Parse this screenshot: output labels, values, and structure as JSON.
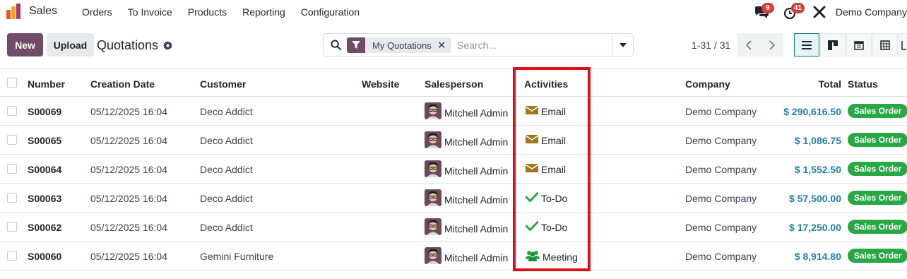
{
  "nav": {
    "app_name": "Sales",
    "menu": [
      "Orders",
      "To Invoice",
      "Products",
      "Reporting",
      "Configuration"
    ],
    "messages_count": "9",
    "activities_count": "41",
    "company": "Demo Company"
  },
  "control": {
    "new_label": "New",
    "upload_label": "Upload",
    "title": "Quotations",
    "facet_label": "My Quotations",
    "search_placeholder": "Search...",
    "pager": "1-31 / 31"
  },
  "columns": {
    "number": "Number",
    "creation_date": "Creation Date",
    "customer": "Customer",
    "website": "Website",
    "salesperson": "Salesperson",
    "activities": "Activities",
    "company": "Company",
    "total": "Total",
    "status": "Status"
  },
  "rows": [
    {
      "number": "S00069",
      "date": "05/12/2025 16:04",
      "customer": "Deco Addict",
      "salesperson": "Mitchell Admin",
      "activity": "Email",
      "activity_icon": "envelope-icon",
      "company": "Demo Company",
      "total": "$ 290,616.50",
      "status": "Sales Order"
    },
    {
      "number": "S00065",
      "date": "05/12/2025 16:04",
      "customer": "Deco Addict",
      "salesperson": "Mitchell Admin",
      "activity": "Email",
      "activity_icon": "envelope-icon",
      "company": "Demo Company",
      "total": "$ 1,086.75",
      "status": "Sales Order"
    },
    {
      "number": "S00064",
      "date": "05/12/2025 16:04",
      "customer": "Deco Addict",
      "salesperson": "Mitchell Admin",
      "activity": "Email",
      "activity_icon": "envelope-icon",
      "company": "Demo Company",
      "total": "$ 1,552.50",
      "status": "Sales Order"
    },
    {
      "number": "S00063",
      "date": "05/12/2025 16:04",
      "customer": "Deco Addict",
      "salesperson": "Mitchell Admin",
      "activity": "To-Do",
      "activity_icon": "check-icon",
      "company": "Demo Company",
      "total": "$ 57,500.00",
      "status": "Sales Order"
    },
    {
      "number": "S00062",
      "date": "05/12/2025 16:04",
      "customer": "Deco Addict",
      "salesperson": "Mitchell Admin",
      "activity": "To-Do",
      "activity_icon": "check-icon",
      "company": "Demo Company",
      "total": "$ 17,250.00",
      "status": "Sales Order"
    },
    {
      "number": "S00060",
      "date": "05/12/2025 16:04",
      "customer": "Gemini Furniture",
      "salesperson": "Mitchell Admin",
      "activity": "Meeting",
      "activity_icon": "users-icon",
      "company": "Demo Company",
      "total": "$ 8,914.80",
      "status": "Sales Order"
    }
  ],
  "colors": {
    "brand": "#714b67",
    "status_green": "#28a745",
    "total_blue": "#1f7ea6",
    "highlight_red": "#e0101a",
    "email_icon": "#a07818",
    "todo_icon": "#28a745"
  }
}
